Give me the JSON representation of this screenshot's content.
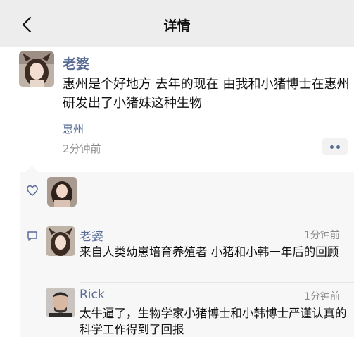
{
  "header": {
    "title": "详情"
  },
  "post": {
    "author": "老婆",
    "text": "惠州是个好地方 去年的现在 由我和小猪博士在惠州研发出了小猪妹这种生物",
    "location": "惠州",
    "time": "2分钟前"
  },
  "comments": [
    {
      "name": "老婆",
      "time": "1分钟前",
      "text": "来自人类幼崽培育养殖者 小猪和小韩一年后的回顾"
    },
    {
      "name": "Rick",
      "time": "1分钟前",
      "text": "太牛逼了，生物学家小猪博士和小韩博士严谨认真的科学工作得到了回报"
    }
  ],
  "colors": {
    "link": "#576b95",
    "topbar": "#ededed",
    "panel": "#f7f7f7"
  }
}
